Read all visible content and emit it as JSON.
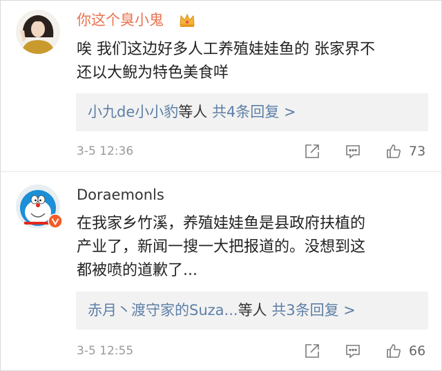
{
  "comments": [
    {
      "username": "你这个臭小鬼",
      "badge_icon": "crown-icon",
      "text_lines": [
        "唉 我们这边好多人工养殖娃娃鱼的 张家界不",
        "还以大鲵为特色美食咩"
      ],
      "reply_preview": {
        "users": "小九de小小豹",
        "suffix": "等人",
        "action": "共4条回复 >"
      },
      "timestamp": "3-5 12:36",
      "like_count": "73"
    },
    {
      "username": "Doraemonls",
      "badge_icon": "verified-v-icon",
      "text_lines": [
        "在我家乡竹溪，养殖娃娃鱼是县政府扶植的",
        "产业了，新闻一搜一大把报道的。没想到这",
        "都被喷的道歉了..."
      ],
      "reply_preview": {
        "users": "赤月丶渡守家的Suza...",
        "suffix": "等人",
        "action": "共3条回复 >"
      },
      "timestamp": "3-5 12:55",
      "like_count": "66"
    }
  ],
  "colors": {
    "highlight_username": "#eb7350",
    "link": "#5d7fa6",
    "reply_bg": "#f2f2f2",
    "meta": "#9a9a9a"
  }
}
